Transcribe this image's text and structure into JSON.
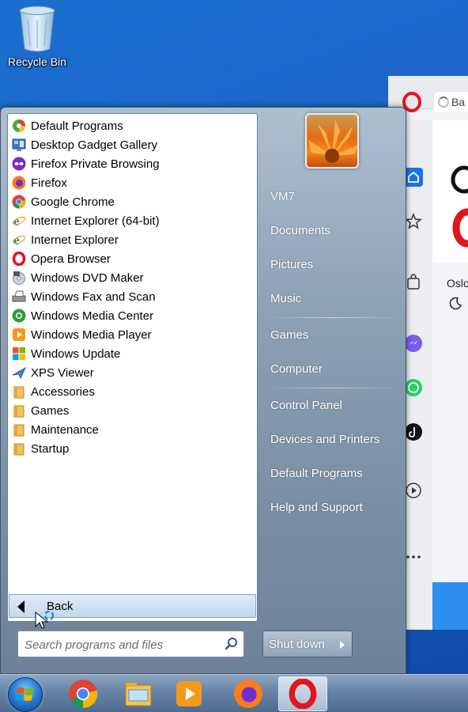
{
  "desktop": {
    "recycle_bin_label": "Recycle Bin"
  },
  "background_window": {
    "tab_label": "Ba",
    "weather_city": "Oslo"
  },
  "start_menu": {
    "programs": [
      {
        "label": "Default Programs",
        "icon": "default-programs-icon"
      },
      {
        "label": "Desktop Gadget Gallery",
        "icon": "gadget-gallery-icon"
      },
      {
        "label": "Firefox Private Browsing",
        "icon": "firefox-private-icon"
      },
      {
        "label": "Firefox",
        "icon": "firefox-icon"
      },
      {
        "label": "Google Chrome",
        "icon": "chrome-icon"
      },
      {
        "label": "Internet Explorer (64-bit)",
        "icon": "internet-explorer-icon"
      },
      {
        "label": "Internet Explorer",
        "icon": "internet-explorer-icon"
      },
      {
        "label": "Opera Browser",
        "icon": "opera-icon"
      },
      {
        "label": "Windows DVD Maker",
        "icon": "dvd-maker-icon"
      },
      {
        "label": "Windows Fax and Scan",
        "icon": "fax-scan-icon"
      },
      {
        "label": "Windows Media Center",
        "icon": "media-center-icon"
      },
      {
        "label": "Windows Media Player",
        "icon": "media-player-icon"
      },
      {
        "label": "Windows Update",
        "icon": "windows-update-icon"
      },
      {
        "label": "XPS Viewer",
        "icon": "xps-viewer-icon"
      },
      {
        "label": "Accessories",
        "icon": "folder-icon"
      },
      {
        "label": "Games",
        "icon": "folder-icon"
      },
      {
        "label": "Maintenance",
        "icon": "folder-icon"
      },
      {
        "label": "Startup",
        "icon": "folder-icon"
      }
    ],
    "back_label": "Back",
    "search_placeholder": "Search programs and files",
    "right_items": [
      "VM7",
      "Documents",
      "Pictures",
      "Music",
      "Games",
      "Computer",
      "Control Panel",
      "Devices and Printers",
      "Default Programs",
      "Help and Support"
    ],
    "shutdown_label": "Shut down"
  },
  "taskbar": {
    "items": [
      "start-orb-icon",
      "chrome-icon",
      "file-explorer-icon",
      "media-player-icon",
      "firefox-icon",
      "opera-icon"
    ],
    "active_item": "opera-icon"
  }
}
